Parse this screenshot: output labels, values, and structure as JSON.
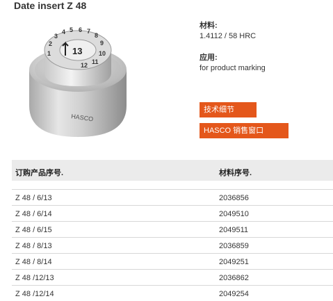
{
  "product": {
    "title": "Date insert Z 48",
    "material_label": "材料:",
    "material_value": "1.4112 / 58 HRC",
    "application_label": "应用:",
    "application_value": "for product marking"
  },
  "buttons": {
    "tech_details": "技术细节",
    "hasco_sales": "HASCO 销售窗口"
  },
  "image": {
    "numbers": [
      "1",
      "2",
      "3",
      "4",
      "5",
      "6",
      "7",
      "8",
      "9",
      "10",
      "11",
      "12"
    ],
    "center_digit": "13",
    "body_text": "HASCO",
    "colors": {
      "accent": "#e4571b"
    }
  },
  "table": {
    "headers": [
      "订购产品序号.",
      "材料序号."
    ],
    "rows": [
      [
        "Z 48 / 6/13",
        "2036856"
      ],
      [
        "Z 48 / 6/14",
        "2049510"
      ],
      [
        "Z 48 / 6/15",
        "2049511"
      ],
      [
        "Z 48 / 8/13",
        "2036859"
      ],
      [
        "Z 48 / 8/14",
        "2049251"
      ],
      [
        "Z 48 /12/13",
        "2036862"
      ],
      [
        "Z 48 /12/14",
        "2049254"
      ]
    ]
  }
}
